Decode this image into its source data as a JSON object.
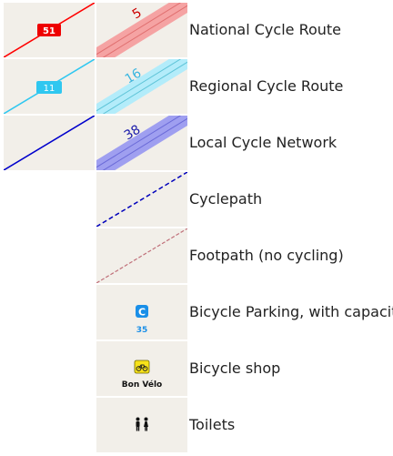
{
  "legend": {
    "rows": [
      {
        "id": "national",
        "label": "National Cycle Route",
        "low_zoom_ref": "51",
        "high_zoom_ref": "5",
        "line_color": "#ff0000",
        "halo_color": "#f5a3a3",
        "ref_text_color": "#cc0000"
      },
      {
        "id": "regional",
        "label": "Regional Cycle Route",
        "low_zoom_ref": "11",
        "high_zoom_ref": "16",
        "line_color": "#2fc7f0",
        "halo_color": "#b3ecfa",
        "ref_text_color": "#3ab6e0"
      },
      {
        "id": "local",
        "label": "Local Cycle Network",
        "high_zoom_ref": "38",
        "line_color": "#0000cc",
        "halo_color": "#9f9ff0",
        "ref_text_color": "#1a1aaa"
      },
      {
        "id": "cyclepath",
        "label": "Cyclepath",
        "line_color": "#0000bb"
      },
      {
        "id": "footpath",
        "label": "Footpath (no cycling)",
        "line_color": "#c0707a"
      },
      {
        "id": "parking",
        "label": "Bicycle Parking, with capacity",
        "icon_letter": "C",
        "capacity": "35",
        "icon_color": "#1a8fe8"
      },
      {
        "id": "shop",
        "label": "Bicycle shop",
        "shop_name": "Bon Vélo",
        "icon_color": "#f7e21a"
      },
      {
        "id": "toilets",
        "label": "Toilets"
      }
    ]
  }
}
